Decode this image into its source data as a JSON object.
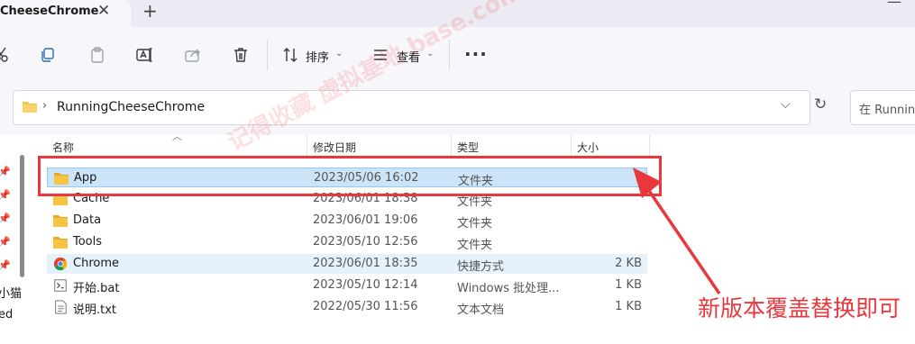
{
  "tab": {
    "title": "CheeseChrome",
    "close_glyph": "✕",
    "new_tab_glyph": "+"
  },
  "toolbar": {
    "sort_label": "排序",
    "view_label": "查看",
    "more_label": "···"
  },
  "address": {
    "path": "RunningCheeseChrome",
    "separator": "›",
    "dropdown_glyph": "⌵",
    "refresh_glyph": "↻",
    "search_placeholder": "在 Runnin"
  },
  "nav": {
    "items": [
      "小猫",
      "ed"
    ]
  },
  "columns": {
    "name": "名称",
    "date": "修改日期",
    "type": "类型",
    "size": "大小"
  },
  "files": [
    {
      "name": "App",
      "date": "2023/05/06 16:02",
      "type": "文件夹",
      "size": "",
      "icon": "folder-icon"
    },
    {
      "name": "Cache",
      "date": "2023/06/01 18:38",
      "type": "文件夹",
      "size": "",
      "icon": "folder-icon"
    },
    {
      "name": "Data",
      "date": "2023/06/01 19:06",
      "type": "文件夹",
      "size": "",
      "icon": "folder-icon"
    },
    {
      "name": "Tools",
      "date": "2023/05/10 12:56",
      "type": "文件夹",
      "size": "",
      "icon": "folder-icon"
    },
    {
      "name": "Chrome",
      "date": "2023/06/01 18:35",
      "type": "快捷方式",
      "size": "2 KB",
      "icon": "chrome-icon"
    },
    {
      "name": "开始.bat",
      "date": "2023/05/10 12:14",
      "type": "Windows 批处理...",
      "size": "1 KB",
      "icon": "batch-file-icon"
    },
    {
      "name": "说明.txt",
      "date": "2022/05/30 11:56",
      "type": "文本文档",
      "size": "1 KB",
      "icon": "text-file-icon"
    }
  ],
  "annotation": {
    "text": "新版本覆盖替换即可"
  },
  "watermark": "记得收藏 虚拟基地 base.com",
  "colors": {
    "accent_red": "#e8383d",
    "selection": "#cce4f7",
    "folder": "#f6c342"
  }
}
